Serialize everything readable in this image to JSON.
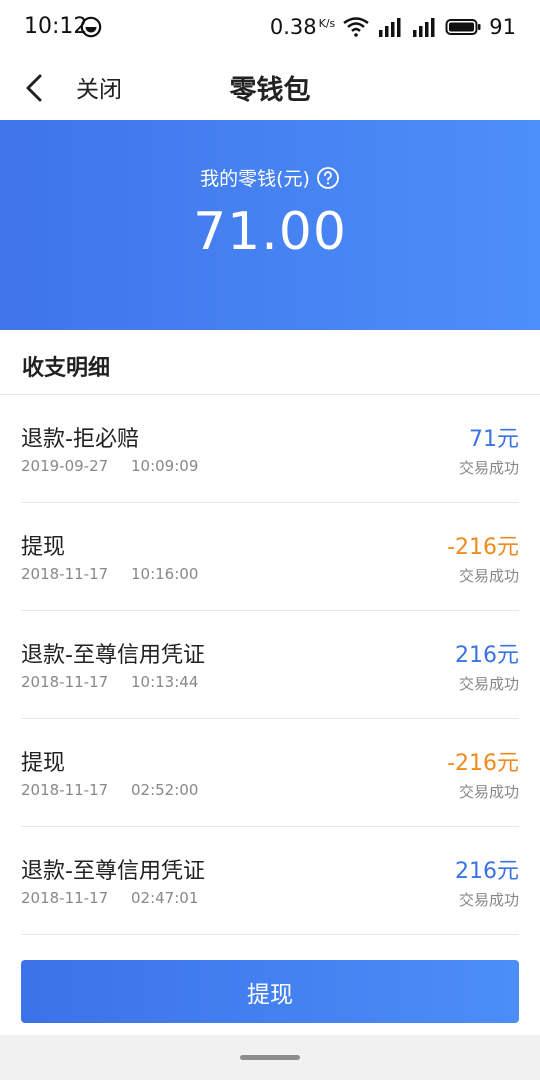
{
  "status_bar": {
    "time": "10:12",
    "network_speed": "0.38",
    "network_speed_unit": "K/s",
    "battery": "91"
  },
  "nav": {
    "close_label": "关闭",
    "title": "零钱包"
  },
  "balance": {
    "label": "我的零钱(元)",
    "amount": "71.00"
  },
  "section": {
    "title": "收支明细"
  },
  "transactions": [
    {
      "title": "退款-拒必赔",
      "date": "2019-09-27",
      "time": "10:09:09",
      "amount": "71元",
      "status": "交易成功"
    },
    {
      "title": "提现",
      "date": "2018-11-17",
      "time": "10:16:00",
      "amount": "-216元",
      "status": "交易成功"
    },
    {
      "title": "退款-至尊信用凭证",
      "date": "2018-11-17",
      "time": "10:13:44",
      "amount": "216元",
      "status": "交易成功"
    },
    {
      "title": "提现",
      "date": "2018-11-17",
      "time": "02:52:00",
      "amount": "-216元",
      "status": "交易成功"
    },
    {
      "title": "退款-至尊信用凭证",
      "date": "2018-11-17",
      "time": "02:47:01",
      "amount": "216元",
      "status": "交易成功"
    }
  ],
  "action": {
    "withdraw_label": "提现"
  },
  "colors": {
    "primary": "#3f74ea",
    "positive": "#3a73e6",
    "negative": "#f08a1c"
  },
  "icons": {
    "back": "chevron-left-icon",
    "help": "question-circle-icon",
    "wifi": "wifi-icon",
    "signal": "signal-icon",
    "battery": "battery-icon"
  }
}
